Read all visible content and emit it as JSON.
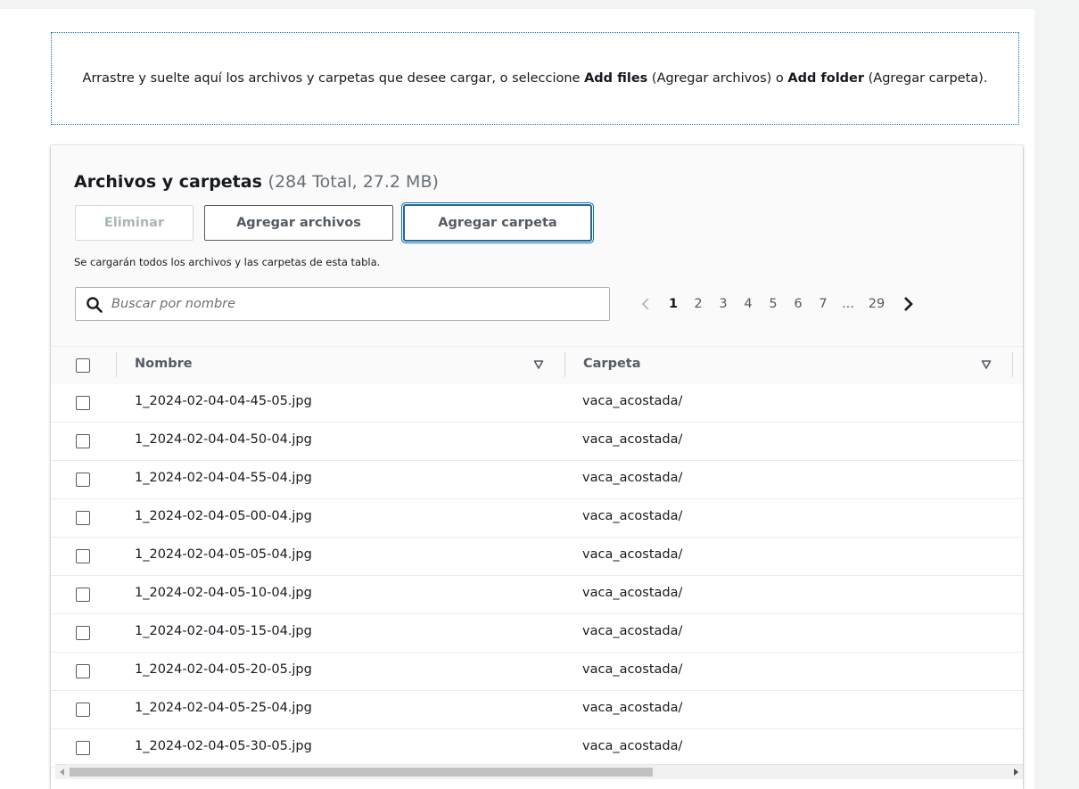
{
  "dropzone": {
    "text_before": "Arrastre y suelte aquí los archivos y carpetas que desee cargar, o seleccione ",
    "add_files_bold": "Add files",
    "text_middle": " (Agregar archivos) o ",
    "add_folder_bold": "Add folder",
    "text_after": " (Agregar carpeta)."
  },
  "panel": {
    "title": "Archivos y carpetas",
    "counter": "(284 Total, 27.2 MB)",
    "buttons": {
      "delete": "Eliminar",
      "add_files": "Agregar archivos",
      "add_folder": "Agregar carpeta"
    },
    "helper_text": "Se cargarán todos los archivos y las carpetas de esta tabla.",
    "search": {
      "placeholder": "Buscar por nombre",
      "value": ""
    },
    "pagination": {
      "current": "1",
      "pages": [
        "1",
        "2",
        "3",
        "4",
        "5",
        "6",
        "7"
      ],
      "ellipsis": "...",
      "last": "29"
    }
  },
  "table": {
    "columns": [
      "Nombre",
      "Carpeta"
    ],
    "rows": [
      {
        "name": "1_2024-02-04-04-45-05.jpg",
        "folder": "vaca_acostada/"
      },
      {
        "name": "1_2024-02-04-04-50-04.jpg",
        "folder": "vaca_acostada/"
      },
      {
        "name": "1_2024-02-04-04-55-04.jpg",
        "folder": "vaca_acostada/"
      },
      {
        "name": "1_2024-02-04-05-00-04.jpg",
        "folder": "vaca_acostada/"
      },
      {
        "name": "1_2024-02-04-05-05-04.jpg",
        "folder": "vaca_acostada/"
      },
      {
        "name": "1_2024-02-04-05-10-04.jpg",
        "folder": "vaca_acostada/"
      },
      {
        "name": "1_2024-02-04-05-15-04.jpg",
        "folder": "vaca_acostada/"
      },
      {
        "name": "1_2024-02-04-05-20-05.jpg",
        "folder": "vaca_acostada/"
      },
      {
        "name": "1_2024-02-04-05-25-04.jpg",
        "folder": "vaca_acostada/"
      },
      {
        "name": "1_2024-02-04-05-30-05.jpg",
        "folder": "vaca_acostada/"
      }
    ]
  },
  "colors": {
    "accent": "#0073bb",
    "text": "#16191f",
    "muted": "#687078",
    "disabled": "#aab7b8",
    "header_bg": "#fafafa"
  },
  "icons": {
    "search": "search-icon",
    "prev": "chevron-left-icon",
    "next": "chevron-right-icon",
    "sort": "sort-caret-down-icon"
  }
}
